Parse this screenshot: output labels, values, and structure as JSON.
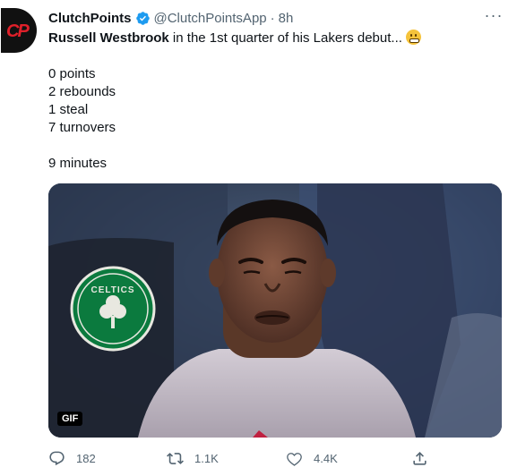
{
  "tweet": {
    "author_name": "ClutchPoints",
    "handle": "@ClutchPointsApp",
    "separator": "·",
    "time": "8h",
    "more_label": "···",
    "avatar_logo": "CP",
    "text_bold": "Russell Westbrook",
    "text_rest": " in the 1st quarter of his Lakers debut...",
    "lines": [
      "0 points",
      "2 rebounds",
      "1 steal",
      "7 turnovers"
    ],
    "minutes": "9 minutes",
    "media_badge": "GIF",
    "media_logo_text": "CELTICS"
  },
  "actions": {
    "replies": "182",
    "retweets": "1.1K",
    "likes": "4.4K"
  },
  "colors": {
    "accent": "#1d9bf0",
    "secondary_text": "#536471",
    "celtics_green": "#0b7a3e"
  },
  "icons": [
    "more-icon",
    "verified-icon",
    "grimace-emoji-icon",
    "reply-icon",
    "retweet-icon",
    "like-icon",
    "share-icon"
  ]
}
